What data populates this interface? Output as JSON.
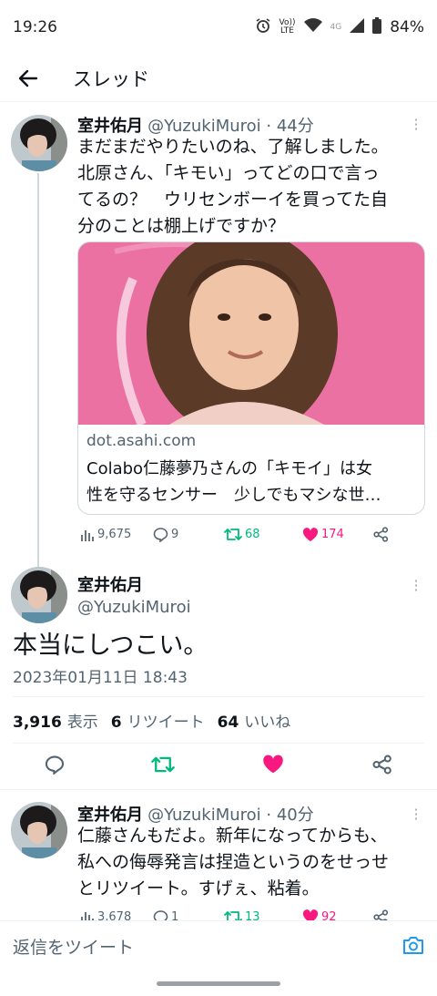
{
  "status": {
    "time": "19:26",
    "battery": "84%",
    "lte_top": "Vo))",
    "lte_bottom": "LTE",
    "network": "4G"
  },
  "header": {
    "title": "スレッド"
  },
  "tweets": [
    {
      "name": "室井佑月",
      "handle_time": "@YuzukiMuroi · 44分",
      "text_lines": [
        "まだまだやりたいのね、了解しました。",
        "北原さん、「キモい」ってどの口で言っ",
        "てるの？　ウリセンボーイを買ってた自",
        "分のことは棚上げですか？"
      ],
      "card": {
        "domain": "dot.asahi.com",
        "title_lines": [
          "Colabo仁藤夢乃さんの「キモイ」は女",
          "性を守るセンサー　少しでもマシな世…"
        ]
      },
      "views": "9,675",
      "replies": "9",
      "retweets": "68",
      "likes": "174"
    },
    {
      "name": "室井佑月",
      "handle": "@YuzukiMuroi",
      "text": "本当にしつこい。",
      "date": "2023年01月11日 18:43",
      "stats": {
        "views": "3,916",
        "views_label": "表示",
        "retweets": "6",
        "retweets_label": "リツイート",
        "likes": "64",
        "likes_label": "いいね"
      }
    },
    {
      "name": "室井佑月",
      "handle_time": "@YuzukiMuroi · 40分",
      "text_lines": [
        "仁藤さんもだよ。新年になってからも、",
        "私への侮辱発言は捏造というのをせっせ",
        "とリツイート。すげぇ、粘着。"
      ],
      "views": "3,678",
      "replies": "1",
      "retweets": "13",
      "likes": "92"
    }
  ],
  "reply_bar": {
    "placeholder": "返信をツイート"
  },
  "colors": {
    "retweet": "#00ba7c",
    "like": "#f91880",
    "link": "#1d9bf0",
    "muted": "#536471"
  }
}
